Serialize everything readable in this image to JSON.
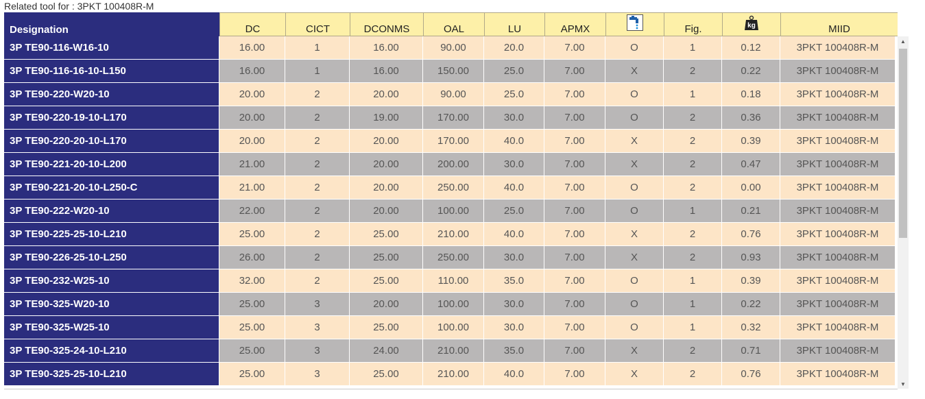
{
  "caption": "Related tool for : 3PKT 100408R-M",
  "columns": [
    {
      "key": "designation",
      "label": "Designation",
      "width": 314
    },
    {
      "key": "dc",
      "label": "DC",
      "width": 96
    },
    {
      "key": "cict",
      "label": "CICT",
      "width": 94
    },
    {
      "key": "dconms",
      "label": "DCONMS",
      "width": 107
    },
    {
      "key": "oal",
      "label": "OAL",
      "width": 89
    },
    {
      "key": "lu",
      "label": "LU",
      "width": 88
    },
    {
      "key": "apmx",
      "label": "APMX",
      "width": 89
    },
    {
      "key": "coolant",
      "label": "",
      "icon": "coolant-tap-icon",
      "width": 85
    },
    {
      "key": "fig",
      "label": "Fig.",
      "width": 85
    },
    {
      "key": "weight",
      "label": "",
      "icon": "weight-kg-icon",
      "icon_text": "kg",
      "width": 85
    },
    {
      "key": "miid",
      "label": "MIID",
      "width": 171
    }
  ],
  "rows": [
    [
      "3P TE90-116-W16-10",
      "16.00",
      "1",
      "16.00",
      "90.00",
      "20.0",
      "7.00",
      "O",
      "1",
      "0.12",
      "3PKT 100408R-M"
    ],
    [
      "3P TE90-116-16-10-L150",
      "16.00",
      "1",
      "16.00",
      "150.00",
      "25.0",
      "7.00",
      "X",
      "2",
      "0.22",
      "3PKT 100408R-M"
    ],
    [
      "3P TE90-220-W20-10",
      "20.00",
      "2",
      "20.00",
      "90.00",
      "25.0",
      "7.00",
      "O",
      "1",
      "0.18",
      "3PKT 100408R-M"
    ],
    [
      "3P TE90-220-19-10-L170",
      "20.00",
      "2",
      "19.00",
      "170.00",
      "30.0",
      "7.00",
      "O",
      "2",
      "0.36",
      "3PKT 100408R-M"
    ],
    [
      "3P TE90-220-20-10-L170",
      "20.00",
      "2",
      "20.00",
      "170.00",
      "40.0",
      "7.00",
      "X",
      "2",
      "0.39",
      "3PKT 100408R-M"
    ],
    [
      "3P TE90-221-20-10-L200",
      "21.00",
      "2",
      "20.00",
      "200.00",
      "30.0",
      "7.00",
      "X",
      "2",
      "0.47",
      "3PKT 100408R-M"
    ],
    [
      "3P TE90-221-20-10-L250-C",
      "21.00",
      "2",
      "20.00",
      "250.00",
      "40.0",
      "7.00",
      "O",
      "2",
      "0.00",
      "3PKT 100408R-M"
    ],
    [
      "3P TE90-222-W20-10",
      "22.00",
      "2",
      "20.00",
      "100.00",
      "25.0",
      "7.00",
      "O",
      "1",
      "0.21",
      "3PKT 100408R-M"
    ],
    [
      "3P TE90-225-25-10-L210",
      "25.00",
      "2",
      "25.00",
      "210.00",
      "40.0",
      "7.00",
      "X",
      "2",
      "0.76",
      "3PKT 100408R-M"
    ],
    [
      "3P TE90-226-25-10-L250",
      "26.00",
      "2",
      "25.00",
      "250.00",
      "30.0",
      "7.00",
      "X",
      "2",
      "0.93",
      "3PKT 100408R-M"
    ],
    [
      "3P TE90-232-W25-10",
      "32.00",
      "2",
      "25.00",
      "110.00",
      "35.0",
      "7.00",
      "O",
      "1",
      "0.39",
      "3PKT 100408R-M"
    ],
    [
      "3P TE90-325-W20-10",
      "25.00",
      "3",
      "20.00",
      "100.00",
      "30.0",
      "7.00",
      "O",
      "1",
      "0.22",
      "3PKT 100408R-M"
    ],
    [
      "3P TE90-325-W25-10",
      "25.00",
      "3",
      "25.00",
      "100.00",
      "30.0",
      "7.00",
      "O",
      "1",
      "0.32",
      "3PKT 100408R-M"
    ],
    [
      "3P TE90-325-24-10-L210",
      "25.00",
      "3",
      "24.00",
      "210.00",
      "35.0",
      "7.00",
      "X",
      "2",
      "0.71",
      "3PKT 100408R-M"
    ],
    [
      "3P TE90-325-25-10-L210",
      "25.00",
      "3",
      "25.00",
      "210.00",
      "40.0",
      "7.00",
      "X",
      "2",
      "0.76",
      "3PKT 100408R-M"
    ]
  ],
  "colors": {
    "designation_bg": "#2b2d7e",
    "header_bg": "#fdf0a8",
    "row_odd_bg": "#fde5c7",
    "row_even_bg": "#b9b7b7"
  }
}
